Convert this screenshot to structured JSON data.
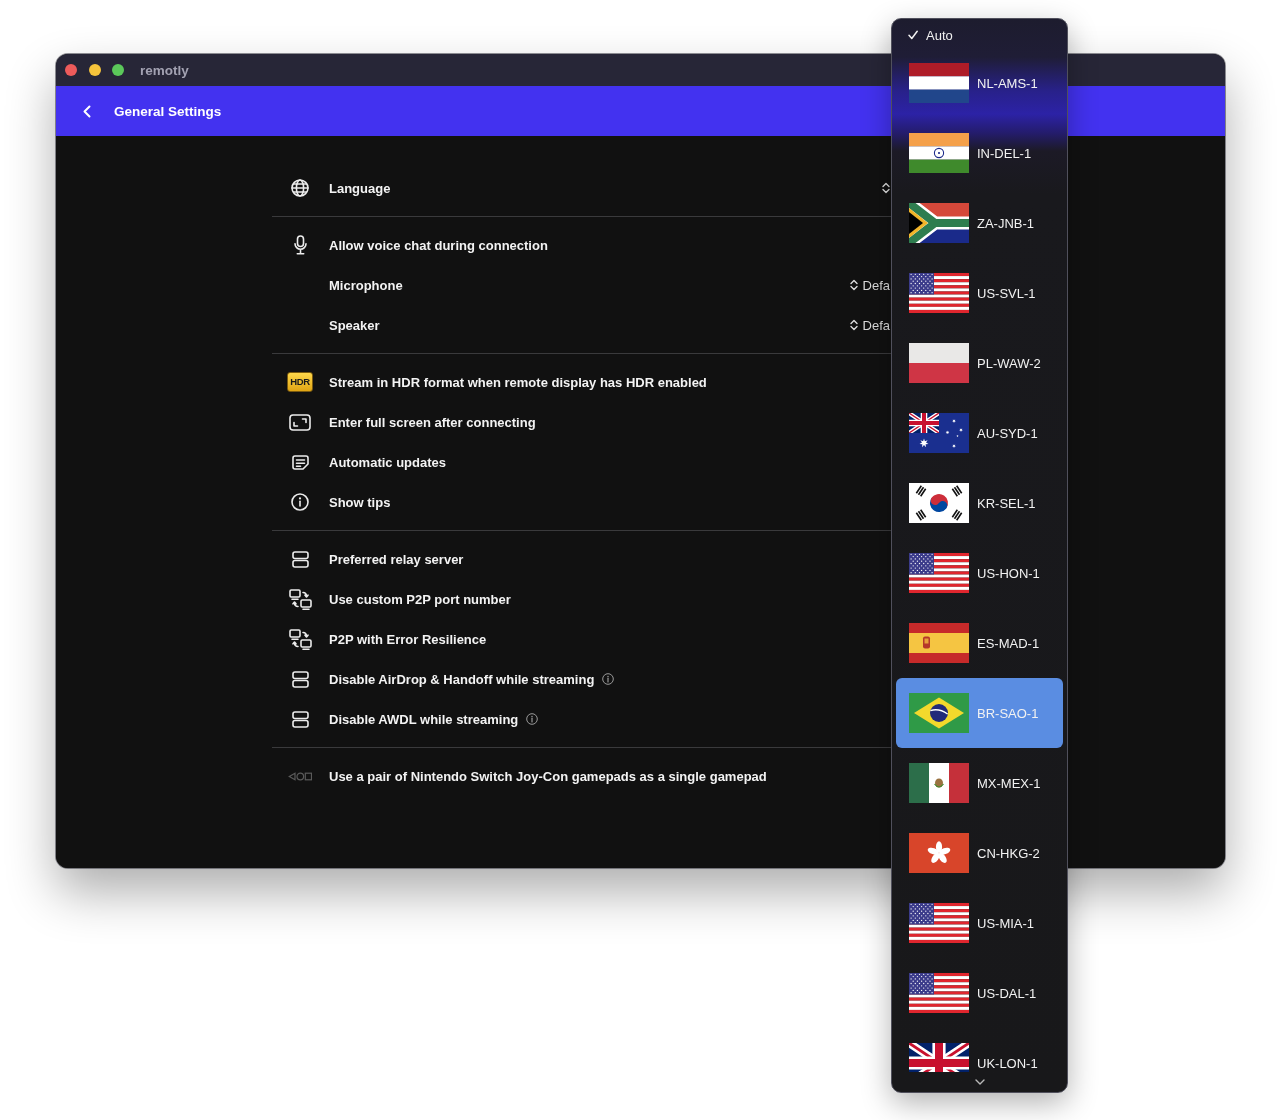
{
  "window": {
    "title": "remotly"
  },
  "header": {
    "title": "General Settings"
  },
  "sections": [
    {
      "rows": [
        {
          "kind": "globe",
          "label": "Language",
          "hint": false,
          "control": {
            "kind": "select"
          }
        }
      ]
    },
    {
      "rows": [
        {
          "kind": "microphone",
          "label": "Allow voice chat during connection",
          "hint": false
        },
        {
          "kind": "plain",
          "label": "Microphone",
          "hint": false,
          "control": {
            "kind": "select",
            "value": "Defa"
          }
        },
        {
          "kind": "plain",
          "label": "Speaker",
          "hint": false,
          "control": {
            "kind": "select",
            "value": "Defa"
          }
        }
      ]
    },
    {
      "rows": [
        {
          "kind": "hdr",
          "badge": "HDR",
          "label": "Stream in HDR format when remote display has HDR enabled",
          "hint": false
        },
        {
          "kind": "fullscreen",
          "label": "Enter full screen after connecting",
          "hint": false
        },
        {
          "kind": "note",
          "label": "Automatic updates",
          "hint": false
        },
        {
          "kind": "info",
          "label": "Show tips",
          "hint": false
        }
      ]
    },
    {
      "rows": [
        {
          "kind": "server",
          "label": "Preferred relay server",
          "hint": false
        },
        {
          "kind": "devices",
          "label": "Use custom P2P port number",
          "hint": false
        },
        {
          "kind": "devices",
          "label": "P2P with Error Resilience",
          "hint": false
        },
        {
          "kind": "server",
          "label": "Disable AirDrop & Handoff while streaming",
          "hint": true
        },
        {
          "kind": "server",
          "label": "Disable AWDL while streaming",
          "hint": true
        }
      ]
    },
    {
      "rows": [
        {
          "kind": "gamepad",
          "label": "Use a pair of Nintendo Switch Joy-Con gamepads as a single gamepad",
          "hint": false
        }
      ]
    }
  ],
  "menu": {
    "auto": {
      "label": "Auto",
      "checked": true
    },
    "options": [
      {
        "kind": "nl",
        "label": "NL-AMS-1",
        "selected": false
      },
      {
        "kind": "in",
        "label": "IN-DEL-1",
        "selected": false
      },
      {
        "kind": "za",
        "label": "ZA-JNB-1",
        "selected": false
      },
      {
        "kind": "us",
        "label": "US-SVL-1",
        "selected": false
      },
      {
        "kind": "pl",
        "label": "PL-WAW-2",
        "selected": false
      },
      {
        "kind": "au",
        "label": "AU-SYD-1",
        "selected": false
      },
      {
        "kind": "kr",
        "label": "KR-SEL-1",
        "selected": false
      },
      {
        "kind": "us",
        "label": "US-HON-1",
        "selected": false
      },
      {
        "kind": "es",
        "label": "ES-MAD-1",
        "selected": false
      },
      {
        "kind": "br",
        "label": "BR-SAO-1",
        "selected": true
      },
      {
        "kind": "mx",
        "label": "MX-MEX-1",
        "selected": false
      },
      {
        "kind": "hk",
        "label": "CN-HKG-2",
        "selected": false
      },
      {
        "kind": "us",
        "label": "US-MIA-1",
        "selected": false
      },
      {
        "kind": "us",
        "label": "US-DAL-1",
        "selected": false
      },
      {
        "kind": "uk",
        "label": "UK-LON-1",
        "selected": false
      }
    ]
  }
}
